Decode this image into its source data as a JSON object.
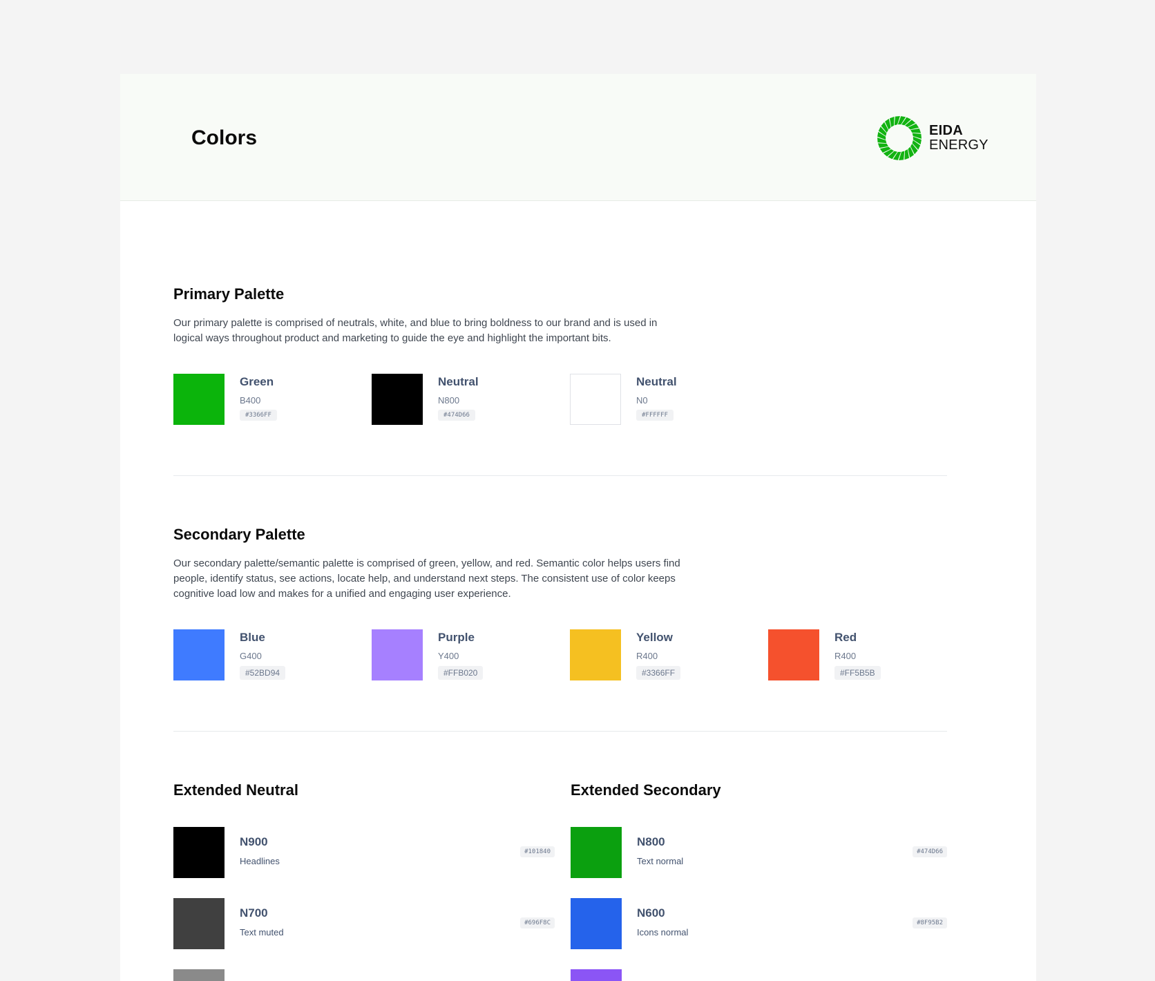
{
  "header": {
    "title": "Colors",
    "logo": {
      "line1": "EIDA",
      "line2": "ENERGY",
      "icon": "sunburst-logo-icon",
      "color": "#12b312"
    }
  },
  "primary": {
    "title": "Primary Palette",
    "description": "Our primary palette is comprised of neutrals, white, and blue to bring boldness to our brand and is used in logical ways throughout product and marketing to guide the eye and highlight the important bits.",
    "swatches": [
      {
        "name": "Green",
        "code": "B400",
        "hex": "#3366FF",
        "color": "#0bb40b"
      },
      {
        "name": "Neutral",
        "code": "N800",
        "hex": "#474D66",
        "color": "#000000"
      },
      {
        "name": "Neutral",
        "code": "N0",
        "hex": "#FFFFFF",
        "color": "#ffffff"
      }
    ]
  },
  "secondary": {
    "title": "Secondary Palette",
    "description": "Our secondary palette/semantic palette is comprised of green, yellow, and red. Semantic color helps users find people, identify status, see actions, locate help, and understand next steps. The consistent use of color keeps cognitive load low and makes for a unified and engaging user experience.",
    "swatches": [
      {
        "name": "Blue",
        "code": "G400",
        "hex": "#52BD94",
        "color": "#3f7bff"
      },
      {
        "name": "Purple",
        "code": "Y400",
        "hex": "#FFB020",
        "color": "#a680ff"
      },
      {
        "name": "Yellow",
        "code": "R400",
        "hex": "#3366FF",
        "color": "#f5c021"
      },
      {
        "name": "Red",
        "code": "R400",
        "hex": "#FF5B5B",
        "color": "#f5512d"
      }
    ]
  },
  "extended_neutral": {
    "title": "Extended Neutral",
    "items": [
      {
        "name": "N900",
        "role": "Headlines",
        "hex": "#101840",
        "color": "#000000"
      },
      {
        "name": "N700",
        "role": "Text muted",
        "hex": "#696F8C",
        "color": "#404040"
      },
      {
        "color": "#8a8a8a"
      }
    ]
  },
  "extended_secondary": {
    "title": "Extended Secondary",
    "items": [
      {
        "name": "N800",
        "role": "Text normal",
        "hex": "#474D66",
        "color": "#0ba00f"
      },
      {
        "name": "N600",
        "role": "Icons normal",
        "hex": "#8F95B2",
        "color": "#2563eb"
      },
      {
        "color": "#8b55f5"
      }
    ]
  }
}
